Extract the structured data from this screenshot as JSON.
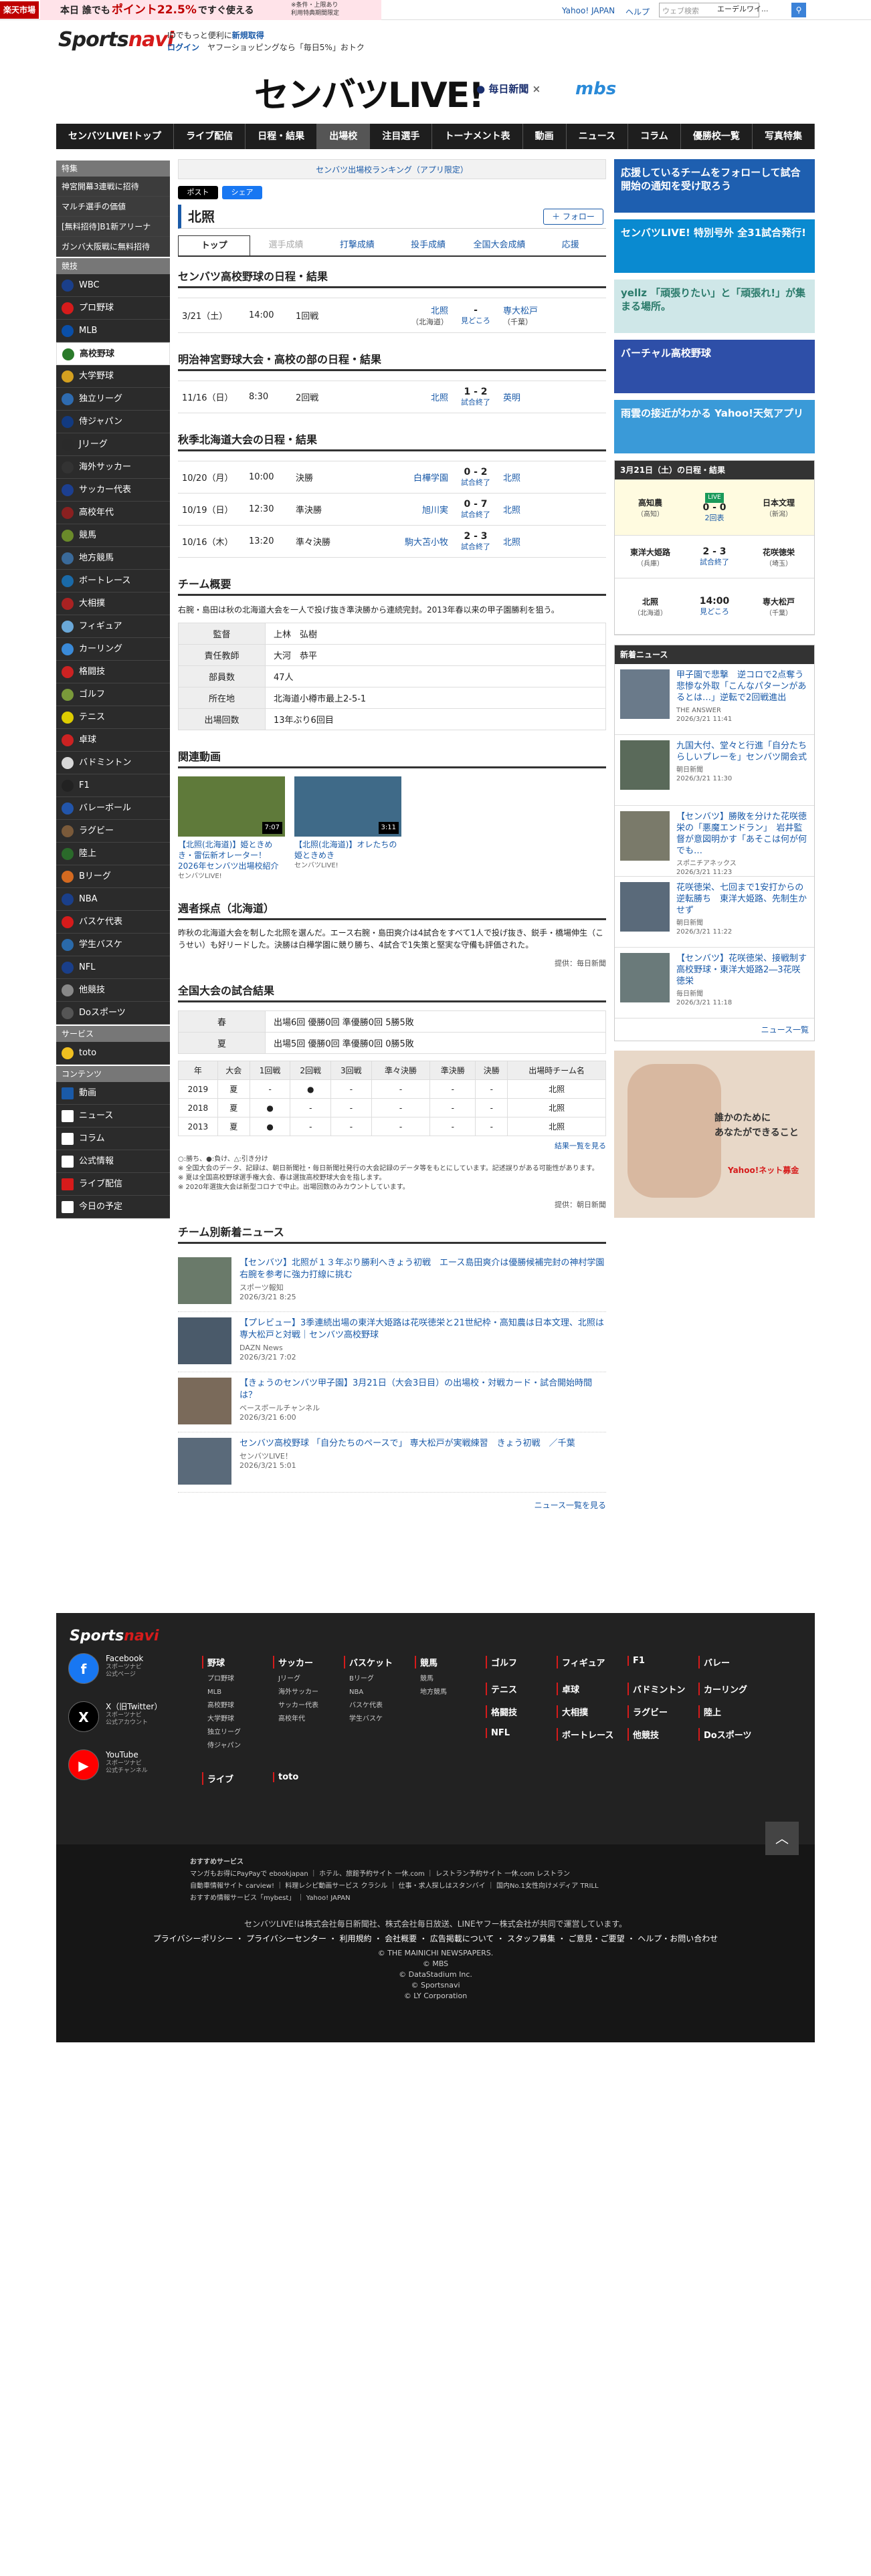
{
  "topbar": {
    "rakuten_logo": "楽天市場",
    "banner_pre": "本日 誰でも",
    "banner_highlight": "ポイント22.5%",
    "banner_post": "ですぐ使える",
    "banner_small": "※条件・上限あり\n利用特典期間限定",
    "yahoo_link": "Yahoo! JAPAN",
    "help_link": "ヘルプ",
    "search_placeholder": "ウェブ検索",
    "search_select": "エーデルワイ..."
  },
  "header": {
    "site_logo_main": "Sports",
    "site_logo_accent": "navi",
    "id_text": "IDでもっと便利に",
    "id_link": "新規取得",
    "login_link": "ログイン",
    "login_text": "ヤフーショッピングなら「毎日5%」おトク",
    "event_logo": "センバツLIVE!",
    "partner1": "毎日新聞",
    "partner_sep": "×",
    "partner2": "mbs"
  },
  "nav": [
    "センバツLIVE!トップ",
    "ライブ配信",
    "日程・結果",
    "出場校",
    "注目選手",
    "トーナメント表",
    "動画",
    "ニュース",
    "コラム",
    "優勝校一覧",
    "写真特集"
  ],
  "sidebar": {
    "special_head": "特集",
    "special": [
      "神宮開幕3連戦に招待",
      "マルチ選手の価値",
      "[無料招待]B1新アリーナ",
      "ガンバ大阪戦に無料招待"
    ],
    "sports_head": "競技",
    "sports": [
      "WBC",
      "プロ野球",
      "MLB",
      "高校野球",
      "大学野球",
      "独立リーグ",
      "侍ジャパン",
      "Jリーグ",
      "海外サッカー",
      "サッカー代表",
      "高校年代",
      "競馬",
      "地方競馬",
      "ボートレース",
      "大相撲",
      "フィギュア",
      "カーリング",
      "格闘技",
      "ゴルフ",
      "テニス",
      "卓球",
      "バドミントン",
      "F1",
      "バレーボール",
      "ラグビー",
      "陸上",
      "Bリーグ",
      "NBA",
      "バスケ代表",
      "学生バスケ",
      "NFL",
      "他競技",
      "Doスポーツ"
    ],
    "service_head": "サービス",
    "services": [
      "toto"
    ],
    "content_head": "コンテンツ",
    "contents": [
      "動画",
      "ニュース",
      "コラム",
      "公式情報",
      "ライブ配信",
      "今日の予定"
    ]
  },
  "main": {
    "ranking_link": "センバツ出場校ランキング（アプリ限定）",
    "share_x": "ポスト",
    "share_fb": "シェア",
    "team_name": "北照",
    "follow": "＋ フォロー",
    "tabs": [
      "トップ",
      "選手成績",
      "打撃成績",
      "投手成績",
      "全国大会成績",
      "応援"
    ],
    "sec1_title": "センバツ高校野球の日程・結果",
    "sec1_games": [
      {
        "date": "3/21（土）",
        "time": "14:00",
        "round": "1回戦",
        "home": "北照",
        "home_pref": "（北海道）",
        "score": "-",
        "status": "見どころ",
        "away": "専大松戸",
        "away_pref": "（千葉）"
      }
    ],
    "sec2_title": "明治神宮野球大会・高校の部の日程・結果",
    "sec2_games": [
      {
        "date": "11/16（日）",
        "time": "8:30",
        "round": "2回戦",
        "home": "北照",
        "score": "1 - 2",
        "status": "試合終了",
        "away": "英明"
      }
    ],
    "sec3_title": "秋季北海道大会の日程・結果",
    "sec3_games": [
      {
        "date": "10/20（月）",
        "time": "10:00",
        "round": "決勝",
        "home": "白樺学園",
        "score": "0 - 2",
        "status": "試合終了",
        "away": "北照"
      },
      {
        "date": "10/19（日）",
        "time": "12:30",
        "round": "準決勝",
        "home": "旭川実",
        "score": "0 - 7",
        "status": "試合終了",
        "away": "北照"
      },
      {
        "date": "10/16（木）",
        "time": "13:20",
        "round": "準々決勝",
        "home": "駒大苫小牧",
        "score": "2 - 3",
        "status": "試合終了",
        "away": "北照"
      }
    ],
    "overview_title": "チーム概要",
    "overview_text": "右腕・島田は秋の北海道大会を一人で投げ抜き準決勝から連続完封。2013年春以来の甲子園勝利を狙う。",
    "overview_rows": [
      {
        "k": "監督",
        "v": "上林　弘樹"
      },
      {
        "k": "責任教師",
        "v": "大河　恭平"
      },
      {
        "k": "部員数",
        "v": "47人"
      },
      {
        "k": "所在地",
        "v": "北海道小樽市最上2-5-1"
      },
      {
        "k": "出場回数",
        "v": "13年ぶり6回目"
      }
    ],
    "video_title": "関連動画",
    "videos": [
      {
        "title": "【北照(北海道)】姫ときめき・雷伝新オレーター！2026年センバツ出場校紹介",
        "source": "センバツLIVE!",
        "duration": "7:07"
      },
      {
        "title": "【北照(北海道)】オレたちの姫ときめき",
        "source": "センバツLIVE!",
        "duration": "3:11"
      }
    ],
    "weekly_title": "週者採点（北海道）",
    "weekly_text": "昨秋の北海道大会を制した北照を選んだ。エース右腕・島田爽介は4試合をすべて1人で投げ抜き、鋭手・橋場伸生（こうせい）も好リードした。決勝は白樺学園に競り勝ち、4試合で1失策と堅実な守備も評価された。",
    "weekly_credit": "提供：毎日新聞",
    "national_title": "全国大会の試合結果",
    "national_rows": [
      {
        "k": "春",
        "v": "出場6回 優勝0回 準優勝0回 5勝5敗"
      },
      {
        "k": "夏",
        "v": "出場5回 優勝0回 準優勝0回 0勝5敗"
      }
    ],
    "year_head": [
      "年",
      "大会",
      "1回戦",
      "2回戦",
      "3回戦",
      "準々決勝",
      "準決勝",
      "決勝",
      "出場時チーム名"
    ],
    "year_rows": [
      [
        "2019",
        "夏",
        "-",
        "●",
        "-",
        "-",
        "-",
        "-",
        "北照"
      ],
      [
        "2018",
        "夏",
        "●",
        "-",
        "-",
        "-",
        "-",
        "-",
        "北照"
      ],
      [
        "2013",
        "夏",
        "●",
        "-",
        "-",
        "-",
        "-",
        "-",
        "北照"
      ]
    ],
    "results_link": "結果一覧を見る",
    "notes": [
      "○:勝ち、●:負け、△:引き分け",
      "※ 全国大会のデータ、記録は、朝日新聞社・毎日新聞社発行の大会記録のデータ等をもとにしています。記述誤りがある可能性があります。",
      "※ 夏は全国高校野球選手権大会、春は選抜高校野球大会を指します。",
      "※ 2020年選抜大会は新型コロナで中止。出場回数のみカウントしています。"
    ],
    "notes_credit": "提供：朝日新聞",
    "team_news_title": "チーム別新着ニュース",
    "team_news": [
      {
        "title": "【センバツ】北照が１３年ぶり勝利へきょう初戦　エース島田爽介は優勝候補完封の神村学園右腕を参考に強力打線に挑む",
        "src": "スポーツ報知",
        "date": "2026/3/21 8:25"
      },
      {
        "title": "【プレビュー】3季連続出場の東洋大姫路は花咲徳栄と21世紀枠・高知農は日本文理、北照は専大松戸と対戦｜センバツ高校野球",
        "src": "DAZN News",
        "date": "2026/3/21 7:02"
      },
      {
        "title": "【きょうのセンバツ甲子園】3月21日（大会3日目）の出場校・対戦カード・試合開始時間は？",
        "src": "ベースボールチャンネル",
        "date": "2026/3/21 6:00"
      },
      {
        "title": "センバツ高校野球 「自分たちのペースで」 専大松戸が実戦練習　きょう初戦　／千葉",
        "src": "センバツLIVE！",
        "date": "2026/3/21 5:01"
      }
    ],
    "news_more": "ニュース一覧を見る"
  },
  "right": {
    "banners": [
      "応援しているチームをフォローして試合開始の通知を受け取ろう",
      "センバツLIVE! 特別号外 全31試合発行!",
      "yellz 「頑張りたい」と「頑張れ!」が集まる場所。",
      "バーチャル高校野球",
      "雨雲の接近がわかる Yahoo!天気アプリ"
    ],
    "schedule_head": "3月21日（土）の日程・結果",
    "games": [
      {
        "home": "高知農",
        "hp": "（高知）",
        "score": "0 - 0",
        "status": "2回表",
        "away": "日本文理",
        "ap": "（新潟）",
        "live": "LIVE"
      },
      {
        "home": "東洋大姫路",
        "hp": "（兵庫）",
        "score": "2 - 3",
        "status": "試合終了",
        "away": "花咲徳栄",
        "ap": "（埼玉）",
        "live": ""
      },
      {
        "home": "北照",
        "hp": "（北海道）",
        "score": "14:00",
        "status": "見どころ",
        "away": "専大松戸",
        "ap": "（千葉）",
        "live": ""
      }
    ],
    "news_head": "新着ニュース",
    "news": [
      {
        "title": "甲子園で悲撃　逆コロで2点奪う悲惨な外取「こんなパターンがあるとは…」逆転で2回戦進出",
        "src": "THE ANSWER",
        "date": "2026/3/21 11:41"
      },
      {
        "title": "九国大付、堂々と行進「自分たちらしいプレーを」センバツ開会式",
        "src": "朝日新聞",
        "date": "2026/3/21 11:30"
      },
      {
        "title": "【センバツ】勝敗を分けた花咲徳栄の「悪魔エンドラン」　岩井監督が意図明かす「あそこは何が何でも…",
        "src": "スポニチアネックス",
        "date": "2026/3/21 11:23"
      },
      {
        "title": "花咲徳栄、七回まで1安打からの逆転勝ち　東洋大姫路、先制生かせず",
        "src": "朝日新聞",
        "date": "2026/3/21 11:22"
      },
      {
        "title": "【センバツ】花咲徳栄、接戦制す　高校野球・東洋大姫路2―3花咲徳栄",
        "src": "毎日新聞",
        "date": "2026/3/21 11:18"
      }
    ],
    "news_more": "ニュース一覧",
    "ad_text": "誰かのために\nあなたができること",
    "ad_brand": "Yahoo!ネット募金"
  },
  "footer": {
    "logo_main": "Sports",
    "logo_accent": "navi",
    "social": [
      {
        "name": "Facebook",
        "desc": "スポーツナビ\n公式ページ",
        "icon": "f"
      },
      {
        "name": "X（旧Twitter）",
        "desc": "スポーツナビ\n公式アカウント",
        "icon": "X"
      },
      {
        "name": "YouTube",
        "desc": "スポーツナビ\n公式チャンネル",
        "icon": "▶"
      }
    ],
    "cols": [
      {
        "h": "野球",
        "items": [
          "プロ野球",
          "MLB",
          "高校野球",
          "大学野球",
          "独立リーグ",
          "侍ジャパン"
        ]
      },
      {
        "h": "サッカー",
        "items": [
          "Jリーグ",
          "海外サッカー",
          "サッカー代表",
          "高校年代"
        ]
      },
      {
        "h": "バスケット",
        "items": [
          "Bリーグ",
          "NBA",
          "バスケ代表",
          "学生バスケ"
        ]
      },
      {
        "h": "競馬",
        "items": [
          "競馬",
          "地方競馬"
        ]
      },
      {
        "h": "ゴルフ",
        "items": []
      },
      {
        "h": "フィギュア",
        "items": []
      },
      {
        "h": "F1",
        "items": []
      },
      {
        "h": "バレー",
        "items": []
      }
    ],
    "cols2": [
      {
        "h": "テニス"
      },
      {
        "h": "卓球"
      },
      {
        "h": "バドミントン"
      },
      {
        "h": "カーリング"
      },
      {
        "h": "格闘技"
      },
      {
        "h": "大相撲"
      },
      {
        "h": "ラグビー"
      },
      {
        "h": "陸上"
      },
      {
        "h": "NFL"
      },
      {
        "h": "ボートレース"
      },
      {
        "h": "他競技"
      },
      {
        "h": "Doスポーツ"
      }
    ],
    "cols3": [
      {
        "h": "ライブ"
      },
      {
        "h": "toto"
      }
    ],
    "rec_head": "おすすめサービス",
    "rec1": "マンガもお得にPayPayで ebookjapan ｜ ホテル、旅館予約サイト 一休.com ｜ レストラン予約サイト 一休.com レストラン",
    "rec2": "自動車情報サイト carview! ｜ 料理レシピ動画サービス クラシル ｜ 仕事・求人探しはスタンバイ ｜ 国内No.1女性向けメディア TRILL",
    "rec3": "おすすめ情報サービス「mybest」 ｜ Yahoo! JAPAN",
    "operator": "センバツLIVE!は株式会社毎日新聞社、株式会社毎日放送、LINEヤフー株式会社が共同で運営しています。",
    "links": "プライバシーポリシー ・ プライバシーセンター ・ 利用規約 ・ 会社概要 ・ 広告掲載について ・ スタッフ募集 ・ ご意見・ご要望 ・ ヘルプ・お問い合わせ",
    "copy1": "© THE MAINICHI NEWSPAPERS.",
    "copy2": "© MBS",
    "copy3": "© DataStadium Inc.",
    "copy4": "© Sportsnavi",
    "copy5": "© LY Corporation",
    "totop": "︿"
  }
}
